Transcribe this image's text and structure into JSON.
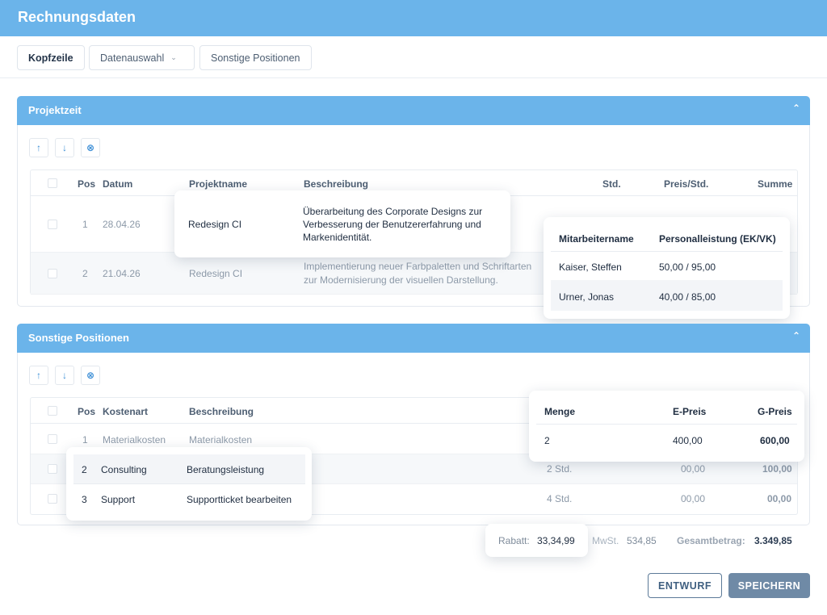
{
  "app": {
    "title": "Rechnungsdaten"
  },
  "tabs": {
    "kopfzeile": "Kopfzeile",
    "datenauswahl": "Datenauswahl",
    "sonstige": "Sonstige Positionen"
  },
  "projektzeit": {
    "title": "Projektzeit",
    "headers": {
      "pos": "Pos",
      "datum": "Datum",
      "projekt": "Projektname",
      "beschreibung": "Beschreibung",
      "std": "Std.",
      "preis": "Preis/Std.",
      "summe": "Summe"
    },
    "rows": [
      {
        "pos": "1",
        "datum": "28.04.26",
        "projekt": "Redesign CI",
        "beschreibung_1": "Überarbeitung des Corporate Designs zur",
        "beschreibung_2": "Verbesserung der Benutzererfahrung und",
        "beschreibung_3": "Markenidentität."
      },
      {
        "pos": "2",
        "datum": "21.04.26",
        "projekt": "Redesign CI",
        "beschreibung_1": "Implementierung neuer Farbpaletten und Schriftarten",
        "beschreibung_2": "zur Modernisierung der visuellen Darstellung."
      }
    ]
  },
  "mitarbeiter_popup": {
    "headers": {
      "name": "Mitarbeitername",
      "leistung": "Personalleistung (EK/VK)"
    },
    "rows": [
      {
        "name": "Kaiser, Steffen",
        "leistung": "50,00 / 95,00"
      },
      {
        "name": "Urner, Jonas",
        "leistung": "40,00 / 85,00"
      }
    ]
  },
  "sonstige": {
    "title": "Sonstige Positionen",
    "headers": {
      "pos": "Pos",
      "kostenart": "Kostenart",
      "beschreibung": "Beschreibung"
    },
    "rows": [
      {
        "pos": "1",
        "kostenart": "Materialkosten",
        "beschreibung": "Materialkosten"
      },
      {
        "pos": "2",
        "kostenart": "Consulting",
        "beschreibung": "Beratungsleistung",
        "menge": "2 Std.",
        "epreis": "00,00",
        "gpreis": "100,00"
      },
      {
        "pos": "3",
        "kostenart": "Support",
        "beschreibung": "Supportticket bearbeiten",
        "menge": "4 Std.",
        "epreis": "00,00",
        "gpreis": "00,00"
      }
    ]
  },
  "preis_popup": {
    "headers": {
      "menge": "Menge",
      "epreis": "E-Preis",
      "gpreis": "G-Preis"
    },
    "row": {
      "menge": "2",
      "epreis": "400,00",
      "gpreis": "600,00"
    }
  },
  "totals": {
    "rabatt_label": "Rabatt:",
    "rabatt": "33,34,99",
    "mwst_label": "MwSt.",
    "mwst": "534,85",
    "gesamt_label": "Gesamtbetrag:",
    "gesamt": "3.349,85"
  },
  "actions": {
    "entwurf": "ENTWURF",
    "speichern": "SPEICHERN"
  },
  "colors": {
    "header": "#6bb4ea",
    "primary_button": "#6f8aa6",
    "accent_icon": "#3d8fd6"
  },
  "icons": {
    "up": "arrow-up-icon",
    "down": "arrow-down-icon",
    "delete": "close-circle-icon",
    "collapse": "chevron-up-icon",
    "dropdown": "chevron-down-icon"
  }
}
